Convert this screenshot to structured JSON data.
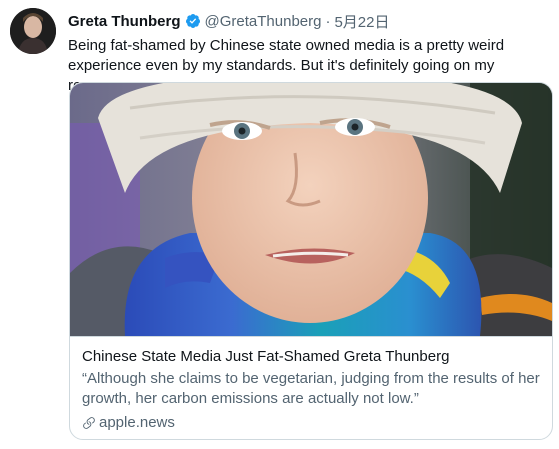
{
  "tweet": {
    "display_name": "Greta Thunberg",
    "handle": "@GretaThunberg",
    "separator": "·",
    "date": "5月22日",
    "text": "Being fat-shamed by Chinese state owned media is a pretty weird experience even by my standards. But it's definitely going on my resume."
  },
  "card": {
    "title": "Chinese State Media Just Fat-Shamed Greta Thunberg",
    "description": "“Although she claims to be vegetarian, judging from the results of her growth, her carbon emissions are actually not low.”",
    "domain": "apple.news"
  },
  "icons": {
    "verified": "verified-badge-icon",
    "link": "link-icon"
  },
  "colors": {
    "verified_blue": "#1d9bf0",
    "text": "#0f1419",
    "secondary_text": "#536471",
    "border": "#cfd9de"
  }
}
